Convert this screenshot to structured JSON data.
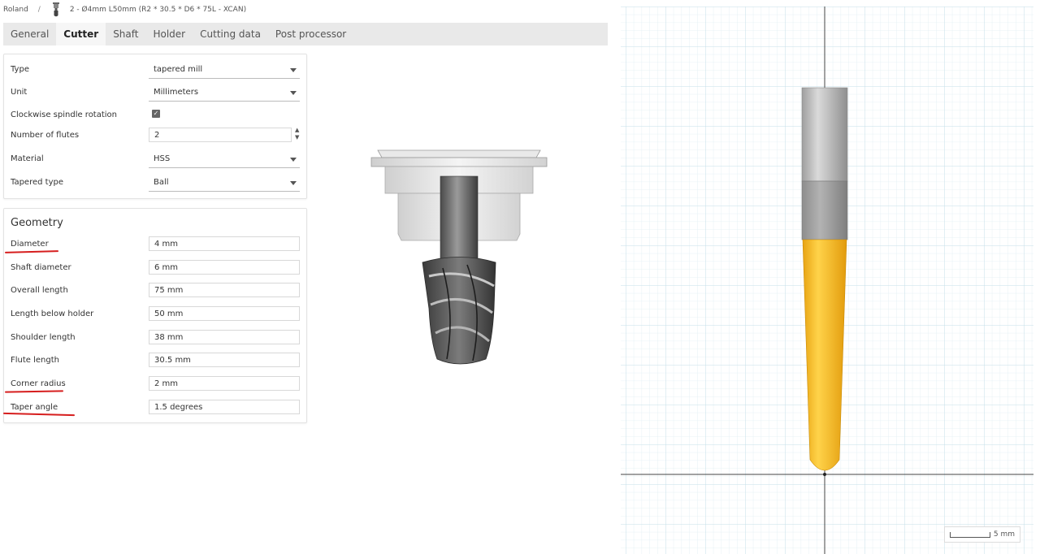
{
  "breadcrumb": {
    "root": "Roland",
    "separator": "/",
    "current": "2 - Ø4mm L50mm (R2 * 30.5 * D6 * 75L - XCAN)"
  },
  "tabs": [
    {
      "label": "General",
      "active": false
    },
    {
      "label": "Cutter",
      "active": true
    },
    {
      "label": "Shaft",
      "active": false
    },
    {
      "label": "Holder",
      "active": false
    },
    {
      "label": "Cutting data",
      "active": false
    },
    {
      "label": "Post processor",
      "active": false
    }
  ],
  "cutter": {
    "type": {
      "label": "Type",
      "value": "tapered mill"
    },
    "unit": {
      "label": "Unit",
      "value": "Millimeters"
    },
    "clockwise": {
      "label": "Clockwise spindle rotation",
      "checked": true
    },
    "flutes": {
      "label": "Number of flutes",
      "value": "2"
    },
    "material": {
      "label": "Material",
      "value": "HSS"
    },
    "tapered_type": {
      "label": "Tapered type",
      "value": "Ball"
    }
  },
  "geometry": {
    "title": "Geometry",
    "diameter": {
      "label": "Diameter",
      "value": "4 mm"
    },
    "shaft_diameter": {
      "label": "Shaft diameter",
      "value": "6 mm"
    },
    "overall_length": {
      "label": "Overall length",
      "value": "75 mm"
    },
    "length_below_holder": {
      "label": "Length below holder",
      "value": "50 mm"
    },
    "shoulder_length": {
      "label": "Shoulder length",
      "value": "38 mm"
    },
    "flute_length": {
      "label": "Flute length",
      "value": "30.5 mm"
    },
    "corner_radius": {
      "label": "Corner radius",
      "value": "2 mm"
    },
    "taper_angle": {
      "label": "Taper angle",
      "value": "1.5 degrees"
    }
  },
  "viewport": {
    "scale_label": "5 mm"
  },
  "colors": {
    "grid": "#cfe6ee",
    "tool_flute": "#f5b81f",
    "shank": "#a8a8a8",
    "annotation": "#d61e1e"
  }
}
